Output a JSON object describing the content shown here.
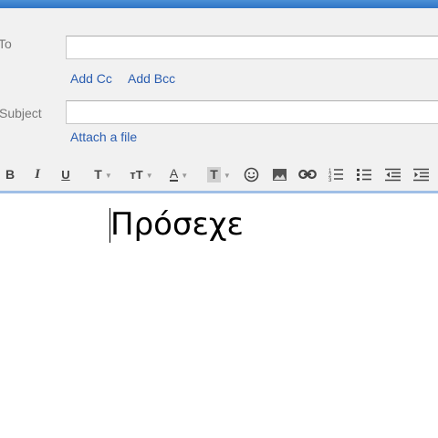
{
  "compose": {
    "to_label": "To",
    "to_value": "",
    "add_cc": "Add Cc",
    "add_bcc": "Add Bcc",
    "subject_label": "Subject",
    "subject_value": "",
    "attach_file": "Attach a file"
  },
  "toolbar": {
    "bold": "B",
    "italic": "I",
    "underline": "U",
    "font": "T",
    "size": "тT",
    "text_color": "A",
    "highlight": "T",
    "icons": [
      "bold-icon",
      "italic-icon",
      "underline-icon",
      "font-family-icon",
      "font-size-icon",
      "text-color-icon",
      "highlight-color-icon",
      "smiley-icon",
      "image-icon",
      "link-icon",
      "numbered-list-icon",
      "bulleted-list-icon",
      "indent-less-icon",
      "indent-more-icon"
    ]
  },
  "body": {
    "text": "Πρόσεχε"
  },
  "colors": {
    "accent_blue": "#2f74c5",
    "link_blue": "#2a5db0",
    "header_bg": "#f1f1f1"
  }
}
